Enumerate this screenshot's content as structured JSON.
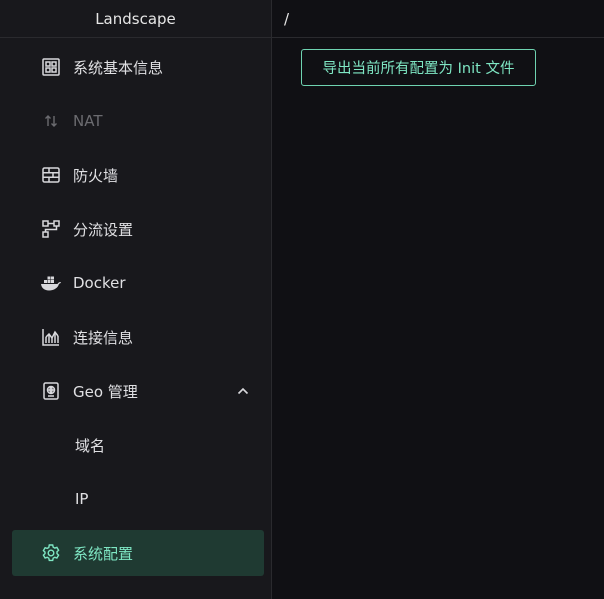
{
  "app": {
    "brand": "Landscape"
  },
  "header": {
    "breadcrumb": "/"
  },
  "sidebar": {
    "items": [
      {
        "label": "系统基本信息",
        "icon": "dashboard-icon"
      },
      {
        "label": "NAT",
        "icon": "swap-vertical-icon",
        "disabled": true
      },
      {
        "label": "防火墙",
        "icon": "firewall-icon"
      },
      {
        "label": "分流设置",
        "icon": "flow-icon"
      },
      {
        "label": "Docker",
        "icon": "docker-icon"
      },
      {
        "label": "连接信息",
        "icon": "chart-icon"
      },
      {
        "label": "Geo 管理",
        "icon": "globe-card-icon",
        "expanded": true
      },
      {
        "label": "域名"
      },
      {
        "label": "IP"
      },
      {
        "label": "系统配置",
        "icon": "gear-icon",
        "active": true
      }
    ]
  },
  "main": {
    "export_button": "导出当前所有配置为 Init 文件"
  },
  "colors": {
    "accent": "#7fe7c4",
    "active_bg": "#1f3a32",
    "sidebar_bg": "#18181c",
    "main_bg": "#101014"
  }
}
